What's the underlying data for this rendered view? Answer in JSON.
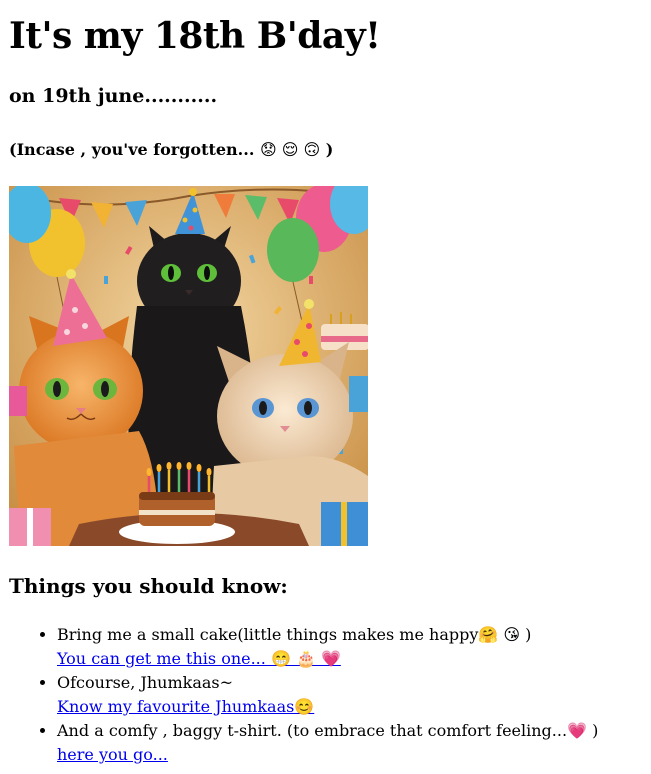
{
  "heading": "It's my 18th B'day!",
  "date_line": "on 19th june...........",
  "note": {
    "text": "(Incase , you've forgotten... ",
    "emojis": "😟 😌 🙃",
    "close": " )"
  },
  "image": {
    "kind": "party-cats-illustration"
  },
  "section_title": "Things you should know:",
  "items": [
    {
      "text": "Bring me a small cake(little things makes me happy",
      "emojis": "🤗 😘",
      "close": " )",
      "link": "You can get me this one... 😁 🎂 💗"
    },
    {
      "text": "Ofcourse, Jhumkaas~",
      "emojis": "",
      "close": "",
      "link": "Know my favourite Jhumkaas😊"
    },
    {
      "text": "And a comfy , baggy t-shirt. (to embrace that comfort feeling...",
      "emojis": "💗",
      "close": " )",
      "link": "here you go..."
    }
  ],
  "colors": {
    "link": "#0000ee",
    "text": "#000000",
    "background": "#ffffff"
  }
}
